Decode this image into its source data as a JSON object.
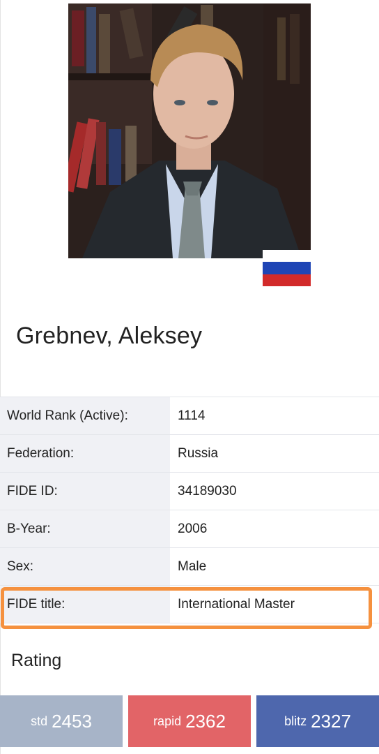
{
  "player": {
    "name": "Grebnev, Aleksey",
    "photo_description": "portrait-photo",
    "flag": "russia-flag"
  },
  "info_rows": [
    {
      "key": "World Rank (Active):",
      "value": "1114"
    },
    {
      "key": "Federation:",
      "value": "Russia"
    },
    {
      "key": "FIDE ID:",
      "value": "34189030"
    },
    {
      "key": "B-Year:",
      "value": "2006"
    },
    {
      "key": "Sex:",
      "value": "Male"
    },
    {
      "key": "FIDE title:",
      "value": "International Master"
    }
  ],
  "rating": {
    "heading": "Rating",
    "tiles": [
      {
        "label": "std",
        "value": "2453",
        "color": "#a7b4c8"
      },
      {
        "label": "rapid",
        "value": "2362",
        "color": "#e26467"
      },
      {
        "label": "blitz",
        "value": "2327",
        "color": "#4e67ad"
      }
    ]
  },
  "colors": {
    "highlight": "#f5913f",
    "flag_white": "#ffffff",
    "flag_blue": "#1f45b5",
    "flag_red": "#d22a2a"
  }
}
